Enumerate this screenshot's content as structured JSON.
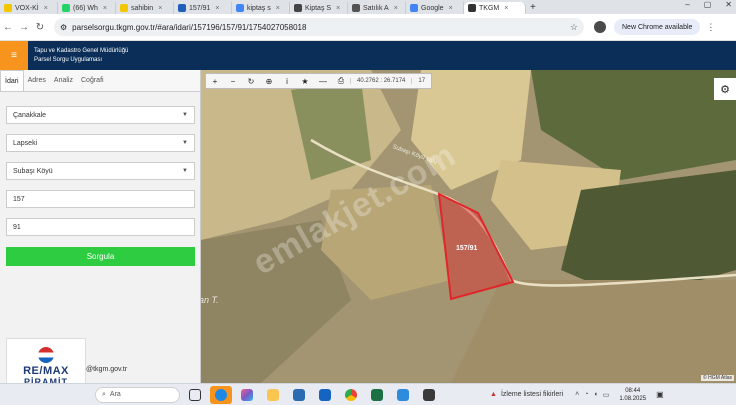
{
  "browser": {
    "tabs": [
      {
        "label": "VOX-Kİ",
        "icon": "s-favicon-icon",
        "color": "#f3c600"
      },
      {
        "label": "(66) Wh",
        "icon": "whatsapp-icon",
        "color": "#25d366"
      },
      {
        "label": "sahibin",
        "icon": "s-favicon-icon",
        "color": "#f3c600"
      },
      {
        "label": "157/91",
        "icon": "tkgm-icon",
        "color": "#1f5fb8"
      },
      {
        "label": "kiptaş s",
        "icon": "google-icon",
        "color": "#4285f4"
      },
      {
        "label": "Kiptaş S",
        "icon": "doc-icon",
        "color": "#444444"
      },
      {
        "label": "Satılık A",
        "icon": "home-icon",
        "color": "#555555"
      },
      {
        "label": "Google",
        "icon": "google-icon",
        "color": "#4285f4"
      },
      {
        "label": "TKGM",
        "icon": "map-pin-icon",
        "color": "#333333",
        "active": true
      }
    ],
    "url": "parselsorgu.tkgm.gov.tr/#ara/idari/157196/157/91/1754027058018",
    "update_label": "New Chrome available"
  },
  "app": {
    "title_line1": "Tapu ve Kadastro Genel Müdürlüğü",
    "title_line2": "Parsel Sorgu Uygulaması",
    "accent_color": "#f7941d",
    "header_color": "#0a2e57"
  },
  "side_panel": {
    "tabs": [
      "İdari",
      "Adres",
      "Analiz",
      "Coğrafi"
    ],
    "province": "Çanakkale",
    "district": "Lapseki",
    "neighborhood": "Subaşı Köyü",
    "block": "157",
    "parcel": "91",
    "query_label": "Sorgula",
    "footer_text": "@tkgm.gov.tr"
  },
  "map": {
    "coordinates": "40.2762 : 26.7174",
    "zoom": "17",
    "parcel_label": "157/91",
    "road_label": "Subaşı Köyü Yolu",
    "place_label": "an T.",
    "watermark": "emlakjet.com",
    "attribution": "© HGM Atlas",
    "parcel_color": "#e0262a"
  },
  "logo": {
    "line1": "RE/MAX",
    "line2": "PİRAMİT"
  },
  "taskbar": {
    "search_placeholder": "Ara",
    "news_label": "İzleme listesi fikirleri",
    "time": "08:44",
    "date": "1.08.2025"
  }
}
